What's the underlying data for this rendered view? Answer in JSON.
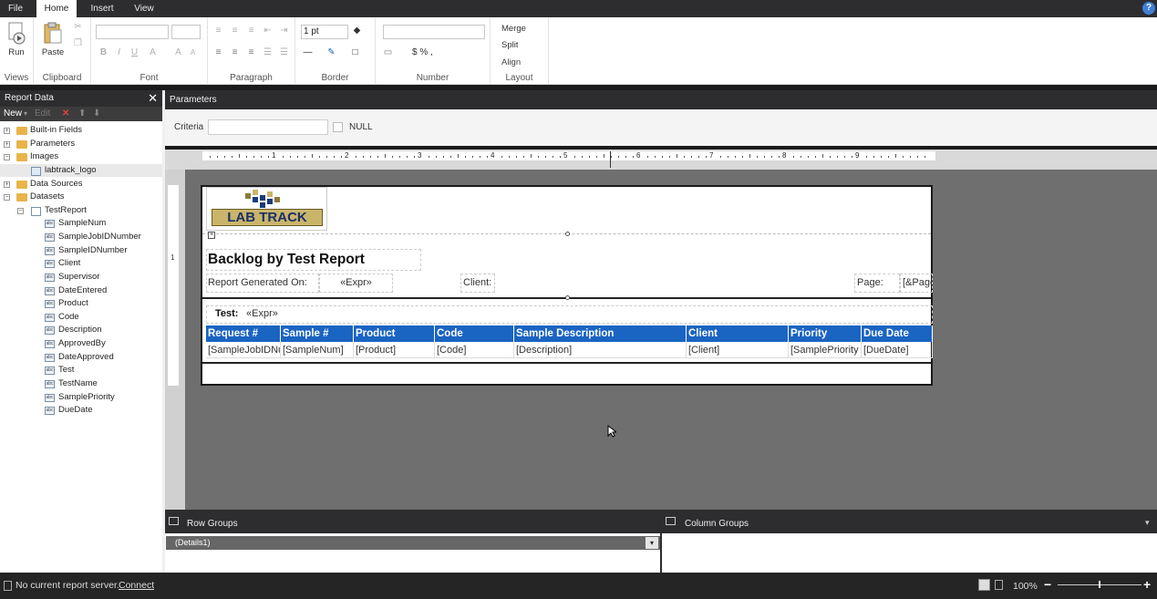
{
  "tabs": [
    {
      "label": "File"
    },
    {
      "label": "Home"
    },
    {
      "label": "Insert"
    },
    {
      "label": "View"
    }
  ],
  "help_label": "?",
  "ribbon": {
    "groups": {
      "views": "Views",
      "clipboard": "Clipboard",
      "font": "Font",
      "paragraph": "Paragraph",
      "border": "Border",
      "number": "Number",
      "layout": "Layout"
    },
    "run_label": "Run",
    "paste_label": "Paste",
    "border_width": "1 pt",
    "number_symbols": "$ % ,",
    "merge_label": "Merge",
    "split_label": "Split",
    "align_label": "Align"
  },
  "report_data": {
    "title": "Report Data",
    "close": "✕",
    "toolbar": {
      "new": "New",
      "edit": "Edit"
    },
    "tree": [
      {
        "label": "Built-in Fields",
        "kind": "folder",
        "level": 0,
        "expander": "+"
      },
      {
        "label": "Parameters",
        "kind": "folder",
        "level": 0,
        "expander": "+"
      },
      {
        "label": "Images",
        "kind": "folder",
        "level": 0,
        "expander": "−"
      },
      {
        "label": "labtrack_logo",
        "kind": "image",
        "level": 1,
        "expander": ""
      },
      {
        "label": "Data Sources",
        "kind": "folder",
        "level": 0,
        "expander": "+"
      },
      {
        "label": "Datasets",
        "kind": "folder",
        "level": 0,
        "expander": "−"
      },
      {
        "label": "TestReport",
        "kind": "dataset",
        "level": 1,
        "expander": "−"
      },
      {
        "label": "SampleNum",
        "kind": "field",
        "level": 2,
        "expander": ""
      },
      {
        "label": "SampleJobIDNumber",
        "kind": "field",
        "level": 2,
        "expander": ""
      },
      {
        "label": "SampleIDNumber",
        "kind": "field",
        "level": 2,
        "expander": ""
      },
      {
        "label": "Client",
        "kind": "field",
        "level": 2,
        "expander": ""
      },
      {
        "label": "Supervisor",
        "kind": "field",
        "level": 2,
        "expander": ""
      },
      {
        "label": "DateEntered",
        "kind": "field",
        "level": 2,
        "expander": ""
      },
      {
        "label": "Product",
        "kind": "field",
        "level": 2,
        "expander": ""
      },
      {
        "label": "Code",
        "kind": "field",
        "level": 2,
        "expander": ""
      },
      {
        "label": "Description",
        "kind": "field",
        "level": 2,
        "expander": ""
      },
      {
        "label": "ApprovedBy",
        "kind": "field",
        "level": 2,
        "expander": ""
      },
      {
        "label": "DateApproved",
        "kind": "field",
        "level": 2,
        "expander": ""
      },
      {
        "label": "Test",
        "kind": "field",
        "level": 2,
        "expander": ""
      },
      {
        "label": "TestName",
        "kind": "field",
        "level": 2,
        "expander": ""
      },
      {
        "label": "SamplePriority",
        "kind": "field",
        "level": 2,
        "expander": ""
      },
      {
        "label": "DueDate",
        "kind": "field",
        "level": 2,
        "expander": ""
      }
    ]
  },
  "parameters": {
    "title": "Parameters",
    "criteria_label": "Criteria",
    "criteria_value": "",
    "null_label": "NULL"
  },
  "ruler": [
    "1",
    "2",
    "3",
    "4",
    "5",
    "6",
    "7",
    "8",
    "9"
  ],
  "report": {
    "logo_text": "LAB TRACK",
    "title": "Backlog by Test Report",
    "generated_label": "Report Generated On:",
    "generated_expr": "«Expr»",
    "client_label": "Client:",
    "page_label": "Page:",
    "page_expr": "[&Page",
    "test_label": "Test:",
    "test_expr": "«Expr»",
    "columns": [
      "Request #",
      "Sample #",
      "Product",
      "Code",
      "Sample Description",
      "Client",
      "Priority",
      "Due Date"
    ],
    "row": [
      "[SampleJobIDNu",
      "[SampleNum]",
      "[Product]",
      "[Code]",
      "[Description]",
      "[Client]",
      "[SamplePriority",
      "[DueDate]"
    ]
  },
  "groups": {
    "row_label": "Row Groups",
    "column_label": "Column Groups",
    "details": "(Details1)"
  },
  "status": {
    "server_text": "No current report server.",
    "connect": "Connect",
    "zoom": "100%"
  },
  "colors": {
    "header_blue": "#1a64c2",
    "dark_chrome": "#2d2d30",
    "canvas_gray": "#6f6f6f"
  }
}
